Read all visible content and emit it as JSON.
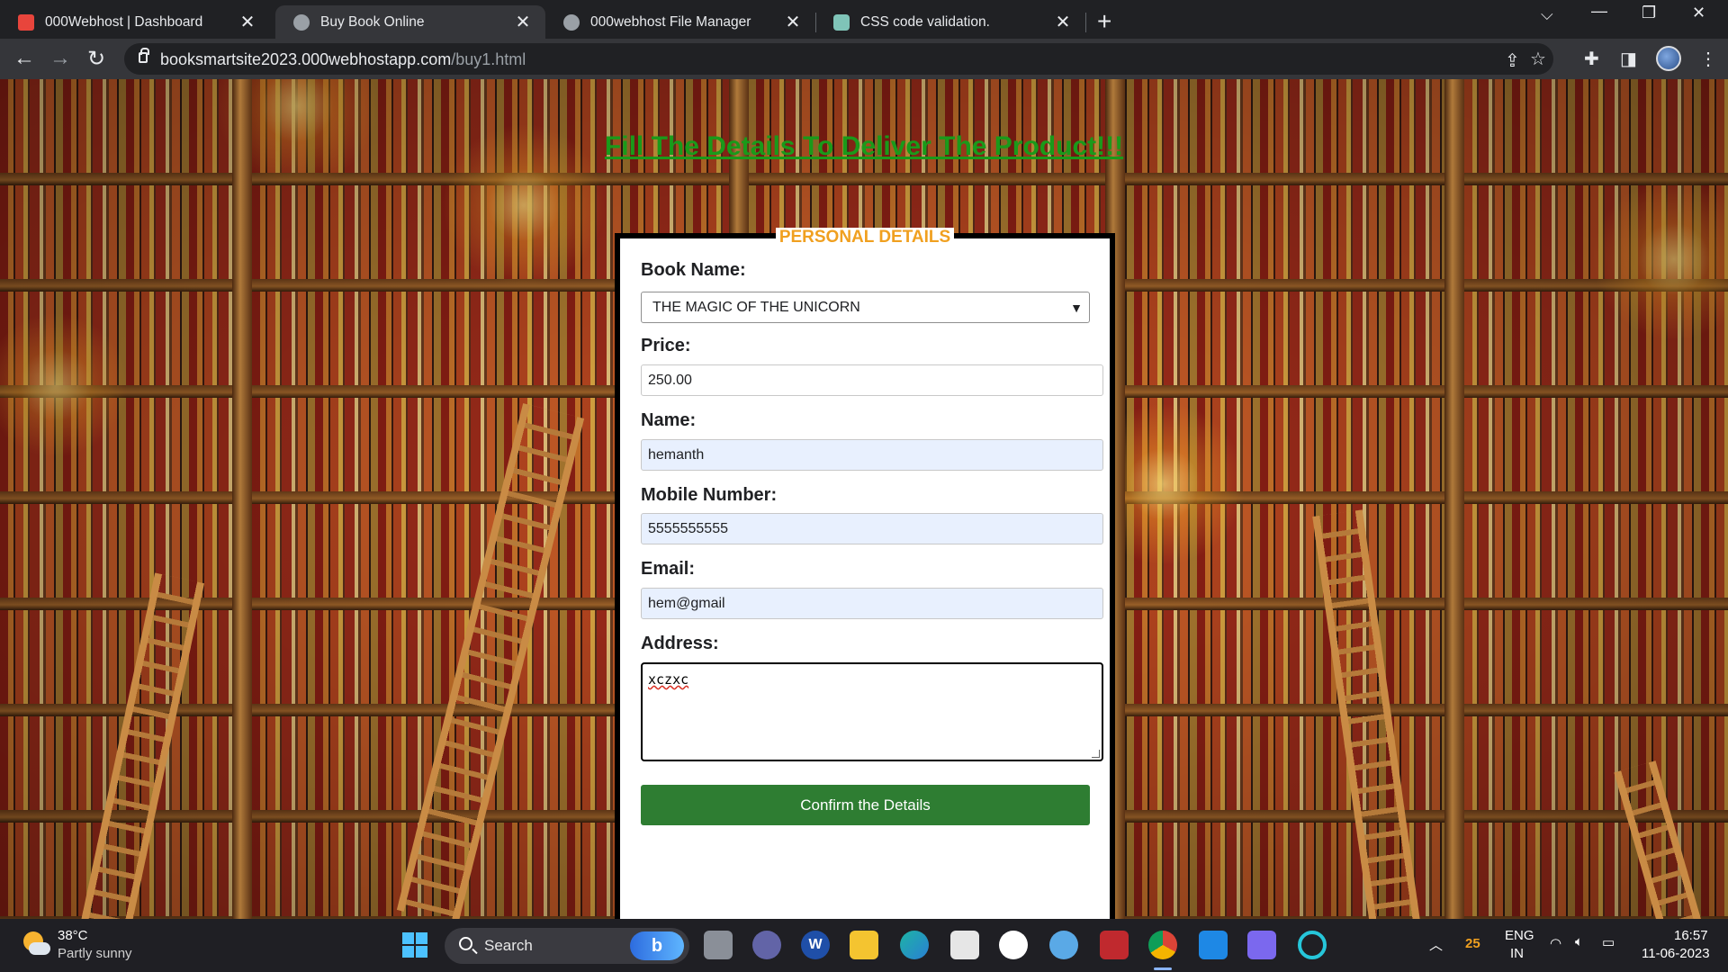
{
  "tabs": [
    {
      "title": "000Webhost | Dashboard",
      "favicon_color": "#e8453c"
    },
    {
      "title": "Buy Book Online",
      "favicon_color": "#9aa0a6"
    },
    {
      "title": "000webhost File Manager",
      "favicon_color": "#9aa0a6"
    },
    {
      "title": "CSS code validation.",
      "favicon_color": "#7fc4b8"
    }
  ],
  "tab_close_glyph": "✕",
  "new_tab_glyph": "+",
  "address_bar": {
    "host": "booksmartsite2023.000webhostapp.com",
    "path": "/buy1.html"
  },
  "page": {
    "heading": "Fill The Details To Deliver The Product!!!",
    "legend": "PERSONAL DETAILS",
    "form": {
      "book_label": "Book Name:",
      "book_value": "THE MAGIC OF THE UNICORN",
      "price_label": "Price:",
      "price_value": "250.00",
      "name_label": "Name:",
      "name_value": "hemanth",
      "mobile_label": "Mobile Number:",
      "mobile_value": "5555555555",
      "email_label": "Email:",
      "email_value": "hem@gmail",
      "address_label": "Address:",
      "address_value": "xczxc",
      "submit_label": "Confirm the Details"
    }
  },
  "taskbar": {
    "weather": {
      "temp": "38°C",
      "condition": "Partly sunny"
    },
    "search_label": "Search",
    "tray": {
      "lang": "ENG",
      "region": "IN",
      "time": "16:57",
      "date": "11-06-2023",
      "badge": "25"
    }
  },
  "colors": {
    "heading": "#1a9a1a",
    "legend": "#f0a020",
    "submit": "#2e7d32",
    "autofill": "#e8f0fe"
  }
}
